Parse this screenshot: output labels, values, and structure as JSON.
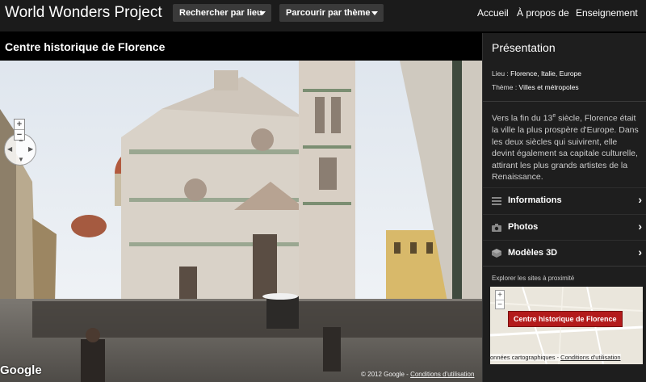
{
  "header": {
    "brand": "World Wonders Project",
    "dropdowns": [
      "Rechercher par lieu",
      "Parcourir par thème"
    ],
    "nav": [
      "Accueil",
      "À propos de",
      "Enseignement"
    ]
  },
  "viewer": {
    "site_title": "Centre historique de Florence",
    "logo": "Google",
    "copyright": "© 2012 Google",
    "separator": "-",
    "terms_link": "Conditions d'utilisation"
  },
  "panel": {
    "title": "Présentation",
    "location_label": "Lieu : ",
    "location_value": "Florence, Italie, Europe",
    "theme_label": "Thème : ",
    "theme_value": "Villes et métropoles",
    "description_pre": "Vers la fin du 13",
    "description_sup": "e",
    "description_post": " siècle, Florence était la ville la plus prospère d'Europe. Dans les deux siècles qui suivirent, elle devint également sa capitale culturelle, attirant les plus grands artistes de la Renaissance.",
    "sections": [
      {
        "label": "Informations",
        "icon": "list-icon"
      },
      {
        "label": "Photos",
        "icon": "camera-icon"
      },
      {
        "label": "Modèles 3D",
        "icon": "cube-icon"
      }
    ],
    "nearby_label": "Explorer les sites à proximité",
    "map_marker": "Centre historique de Florence",
    "map_copyright": "onnées cartographiques",
    "map_separator": "-",
    "map_terms": "Conditions d'utilisation"
  },
  "colors": {
    "topbar": "#1b1b1b",
    "panel": "#1e1e1e",
    "marker": "#b31b1b"
  }
}
